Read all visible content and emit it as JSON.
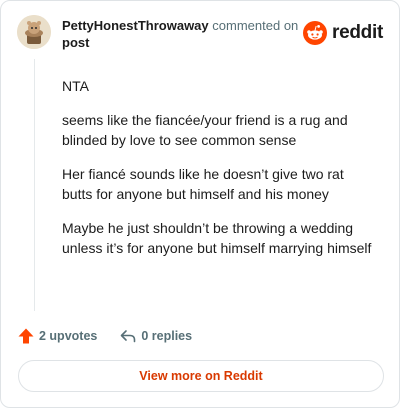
{
  "header": {
    "author": "PettyHonestThrowaway",
    "commented_on": "commented on",
    "post_link": "post",
    "brand": "reddit"
  },
  "comment": {
    "paragraphs": [
      "NTA",
      "seems like the fiancée/your friend is a rug and blinded by love to see common sense",
      "Her fiancé sounds like he doesn’t give two rat butts for anyone but himself and his money",
      "Maybe he just shouldn’t be throwing a wedding unless it’s for anyone but himself marrying himself"
    ]
  },
  "actions": {
    "upvotes": "2 upvotes",
    "replies": "0 replies"
  },
  "view_more": "View more on Reddit",
  "colors": {
    "accent": "#d93900",
    "upvote": "#ff4500",
    "muted": "#576f76",
    "border": "#dfe3e6"
  },
  "icons": {
    "avatar": "snoo-avatar",
    "brand": "reddit-logo-icon",
    "upvote": "upvote-arrow-icon",
    "reply": "reply-arrow-icon"
  }
}
